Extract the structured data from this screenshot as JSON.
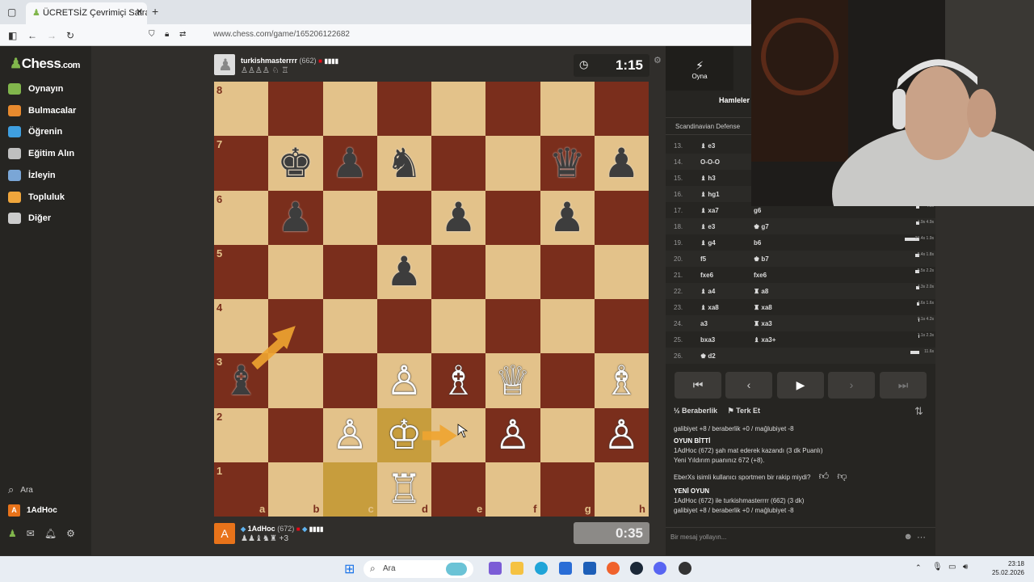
{
  "browser": {
    "tab_title": "ÜCRETSİZ Çevrimiçi Satranç",
    "url": "www.chess.com/game/165206122682"
  },
  "sidebar": {
    "logo_main": "Chess",
    "logo_suffix": ".com",
    "items": [
      {
        "label": "Oynayın",
        "icon": "pawn-play-icon",
        "color": "#81b64c"
      },
      {
        "label": "Bulmacalar",
        "icon": "puzzle-icon",
        "color": "#e88a2e"
      },
      {
        "label": "Öğrenin",
        "icon": "graduation-cap-icon",
        "color": "#3f9fe0"
      },
      {
        "label": "Eğitim Alın",
        "icon": "coach-icon",
        "color": "#bfbfbf"
      },
      {
        "label": "İzleyin",
        "icon": "binoculars-icon",
        "color": "#7aa6d6"
      },
      {
        "label": "Topluluk",
        "icon": "community-icon",
        "color": "#f0a63c"
      },
      {
        "label": "Diğer",
        "icon": "more-icon",
        "color": "#cccccc"
      }
    ],
    "search_label": "Ara",
    "user_label": "1AdHoc",
    "user_initial": "A"
  },
  "top_player": {
    "name": "turkishmasterrrr",
    "rating": "(662)",
    "captured": "♙♙♙♙ ♘ ♖",
    "clock": "1:15"
  },
  "bottom_player": {
    "name": "1AdHoc",
    "rating": "(672)",
    "captured": "♟♟♝♞♜",
    "advantage": "+3",
    "initial": "A",
    "clock": "0:35"
  },
  "board": {
    "ranks": [
      "8",
      "7",
      "6",
      "5",
      "4",
      "3",
      "2",
      "1"
    ],
    "files": [
      "a",
      "b",
      "c",
      "d",
      "e",
      "f",
      "g",
      "h"
    ],
    "pieces": [
      {
        "sq": "b7",
        "glyph": "♚",
        "color": "b"
      },
      {
        "sq": "c7",
        "glyph": "♟",
        "color": "b"
      },
      {
        "sq": "d7",
        "glyph": "♞",
        "color": "b"
      },
      {
        "sq": "g7",
        "glyph": "♛",
        "color": "b"
      },
      {
        "sq": "h7",
        "glyph": "♟",
        "color": "b"
      },
      {
        "sq": "b6",
        "glyph": "♟",
        "color": "b"
      },
      {
        "sq": "e6",
        "glyph": "♟",
        "color": "b"
      },
      {
        "sq": "g6",
        "glyph": "♟",
        "color": "b"
      },
      {
        "sq": "d5",
        "glyph": "♟",
        "color": "b"
      },
      {
        "sq": "a3",
        "glyph": "♝",
        "color": "b"
      },
      {
        "sq": "d3",
        "glyph": "♙",
        "color": "w"
      },
      {
        "sq": "e3",
        "glyph": "♗",
        "color": "w"
      },
      {
        "sq": "f3",
        "glyph": "♕",
        "color": "w"
      },
      {
        "sq": "h3",
        "glyph": "♗",
        "color": "w"
      },
      {
        "sq": "c2",
        "glyph": "♙",
        "color": "w"
      },
      {
        "sq": "d2",
        "glyph": "♔",
        "color": "w"
      },
      {
        "sq": "f2",
        "glyph": "♙",
        "color": "w"
      },
      {
        "sq": "h2",
        "glyph": "♙",
        "color": "w"
      },
      {
        "sq": "d1",
        "glyph": "♖",
        "color": "w"
      }
    ],
    "highlight": [
      "c1",
      "d2"
    ]
  },
  "panel": {
    "play_tab": "Oyna",
    "moves_tab": "Hamleler",
    "opening": "Scandinavian Defense",
    "moves": [
      {
        "n": "13.",
        "w": "♝ e3",
        "b": "",
        "bar": 0,
        "t": ""
      },
      {
        "n": "14.",
        "w": "O-O-O",
        "b": "",
        "bar": 0,
        "t": ""
      },
      {
        "n": "15.",
        "w": "♝ h3",
        "b": "",
        "bar": 0,
        "t": ""
      },
      {
        "n": "16.",
        "w": "♝ hg1",
        "b": "",
        "bar": 0,
        "t": ""
      },
      {
        "n": "17.",
        "w": "♝ xa7",
        "b": "g6",
        "bar": 4,
        "t": "4.5s"
      },
      {
        "n": "18.",
        "w": "♝ e3",
        "b": "♚ g7",
        "bar": 4,
        "t": "1.9s 4.9s"
      },
      {
        "n": "19.",
        "w": "♝ g4",
        "b": "b6",
        "bar": 18,
        "t": "21.4s 1.9s"
      },
      {
        "n": "20.",
        "w": "f5",
        "b": "♚ b7",
        "bar": 5,
        "t": "5.4s 1.8s"
      },
      {
        "n": "21.",
        "w": "fxe6",
        "b": "fxe6",
        "bar": 5,
        "t": "5.5s 2.2s"
      },
      {
        "n": "22.",
        "w": "♝ a4",
        "b": "♜ a8",
        "bar": 4,
        "t": "4.3s 2.0s"
      },
      {
        "n": "23.",
        "w": "♝ xa8",
        "b": "♜ xa8",
        "bar": 3,
        "t": "2.6s 1.6s"
      },
      {
        "n": "24.",
        "w": "a3",
        "b": "♜ xa3",
        "bar": 1,
        "t": "0.1s 4.2s"
      },
      {
        "n": "25.",
        "w": "bxa3",
        "b": "♝ xa3+",
        "bar": 1,
        "t": "1.1s 2.3s"
      },
      {
        "n": "26.",
        "w": "♚ d2",
        "b": "",
        "bar": 11,
        "t": "11.6s"
      }
    ],
    "draw_label": "Beraberlik",
    "resign_label": "Terk Et",
    "chat": {
      "line0": "galibiyet +8 / beraberlik +0 / mağlubiyet -8",
      "over_title": "OYUN BİTTİ",
      "over_line1": "1AdHoc (672) şah mat ederek kazandı (3 dk Puanlı)",
      "over_line2": "Yeni Yıldırım puanınız 672 (+8).",
      "sportsman": "EberXs isimli kullanıcı sportmen bir rakip miydi?",
      "new_title": "YENİ OYUN",
      "new_line1": "1AdHoc (672) ile turkishmasterrrr (662) (3 dk)",
      "new_line2": "galibiyet +8 / beraberlik +0 / mağlubiyet -8"
    },
    "chat_placeholder": "Bir mesaj yollayın..."
  },
  "taskbar": {
    "search": "Ara",
    "time": "23:18",
    "date": "25.02.2026"
  }
}
